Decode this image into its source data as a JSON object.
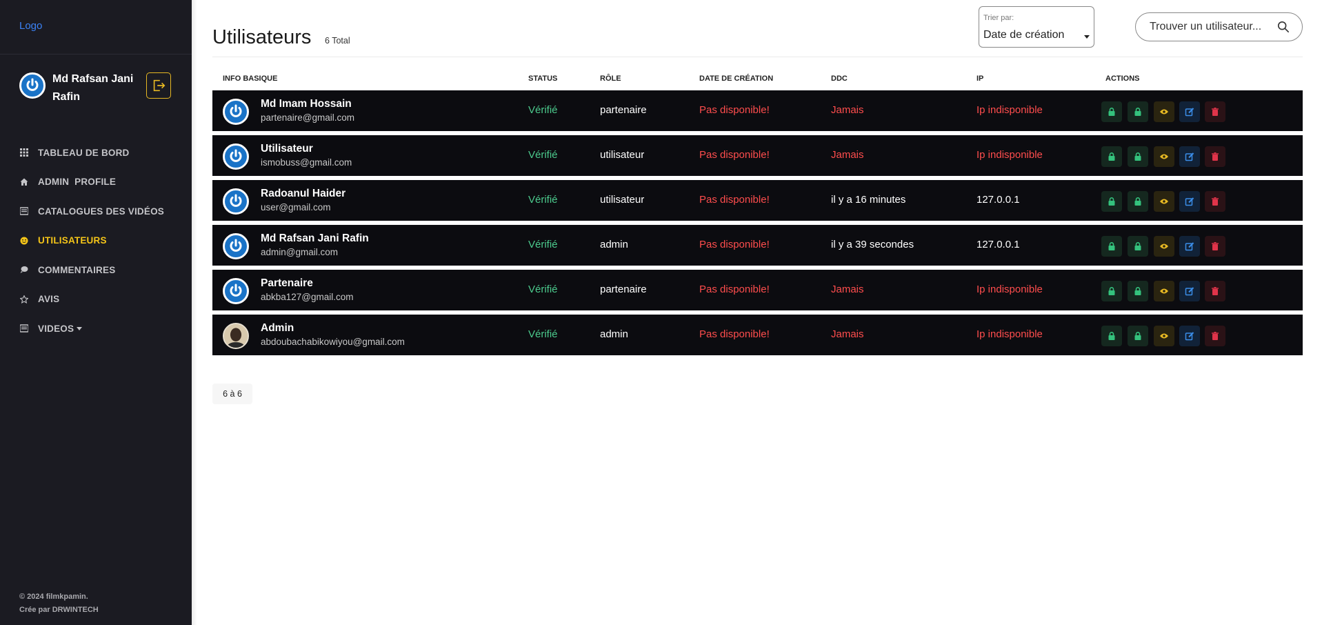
{
  "sidebar": {
    "logo": "Logo",
    "profile_name": "Md Rafsan Jani Rafin",
    "nav": [
      {
        "label": "TABLEAU DE BORD",
        "icon": "grid-icon",
        "active": false
      },
      {
        "label": "ADMIN  PROFILE",
        "icon": "home-icon",
        "active": false
      },
      {
        "label": "CATALOGUES DES VIDÉOS",
        "icon": "list-icon",
        "active": false
      },
      {
        "label": "UTILISATEURS",
        "icon": "user-smile-icon",
        "active": true
      },
      {
        "label": "COMMENTAIRES",
        "icon": "comment-icon",
        "active": false
      },
      {
        "label": "AVIS",
        "icon": "star-icon",
        "active": false
      },
      {
        "label": "VIDEOS",
        "icon": "video-list-icon",
        "active": false
      }
    ],
    "copyright_line1": "© 2024 filmkpamin.",
    "copyright_line2": "Crée par DRWINTECH"
  },
  "header": {
    "title": "Utilisateurs",
    "total": "6 Total",
    "sort_label": "Trier par:",
    "sort_value": "Date de création",
    "search_placeholder": "Trouver un utilisateur..."
  },
  "table": {
    "columns": {
      "info": "INFO BASIQUE",
      "status": "STATUS",
      "role": "RÔLE",
      "created": "DATE DE CRÉATION",
      "ddc": "DDC",
      "ip": "IP",
      "actions": "ACTIONS"
    },
    "rows": [
      {
        "name": "Md Imam Hossain",
        "email": "partenaire@gmail.com",
        "status": "Vérifié",
        "role": "partenaire",
        "created": "Pas disponible!",
        "ddc": "Jamais",
        "ip": "Ip indisponible",
        "avatar": "power-icon"
      },
      {
        "name": "Utilisateur",
        "email": "ismobuss@gmail.com",
        "status": "Vérifié",
        "role": "utilisateur",
        "created": "Pas disponible!",
        "ddc": "Jamais",
        "ip": "Ip indisponible",
        "avatar": "power-icon"
      },
      {
        "name": "Radoanul Haider",
        "email": "user@gmail.com",
        "status": "Vérifié",
        "role": "utilisateur",
        "created": "Pas disponible!",
        "ddc": "il y a 16 minutes",
        "ip": "127.0.0.1",
        "avatar": "power-icon"
      },
      {
        "name": "Md Rafsan Jani Rafin",
        "email": "admin@gmail.com",
        "status": "Vérifié",
        "role": "admin",
        "created": "Pas disponible!",
        "ddc": "il y a 39 secondes",
        "ip": "127.0.0.1",
        "avatar": "power-icon"
      },
      {
        "name": "Partenaire",
        "email": "abkba127@gmail.com",
        "status": "Vérifié",
        "role": "partenaire",
        "created": "Pas disponible!",
        "ddc": "Jamais",
        "ip": "Ip indisponible",
        "avatar": "power-icon"
      },
      {
        "name": "Admin",
        "email": "abdoubachabikowiyou@gmail.com",
        "status": "Vérifié",
        "role": "admin",
        "created": "Pas disponible!",
        "ddc": "Jamais",
        "ip": "Ip indisponible",
        "avatar": "photo"
      }
    ]
  },
  "pagination": "6 à 6",
  "colors": {
    "sidebar_bg": "#1b1b22",
    "accent_yellow": "#f5c518",
    "verified_green": "#4ccb8d",
    "error_red": "#ff4d4d",
    "row_bg": "#0c0c10",
    "link_blue": "#3b82f6"
  }
}
